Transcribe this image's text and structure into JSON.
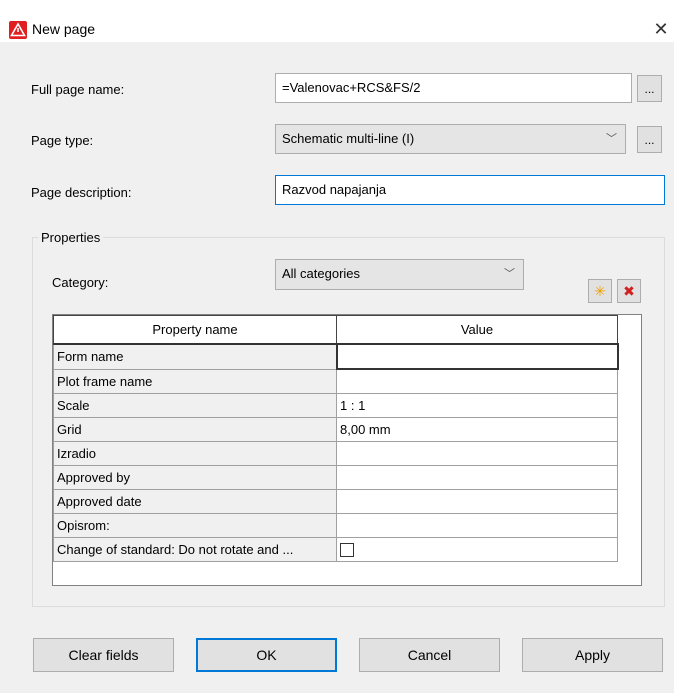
{
  "window": {
    "title": "New page",
    "close_glyph": "✕"
  },
  "form": {
    "full_page_name": {
      "label": "Full page name:",
      "value": "=Valenovac+RCS&FS/2"
    },
    "page_type": {
      "label": "Page type:",
      "value": "Schematic multi-line (I)"
    },
    "page_description": {
      "label": "Page description:",
      "value": "Razvod napajanja"
    },
    "browse_label": "..."
  },
  "properties": {
    "group_title": "Properties",
    "category_label": "Category:",
    "category_value": "All categories",
    "new_icon": "✳",
    "delete_icon": "✖",
    "columns": [
      "Property name",
      "Value"
    ],
    "rows": [
      {
        "name": "Form name",
        "value": ""
      },
      {
        "name": "Plot frame name",
        "value": ""
      },
      {
        "name": "Scale",
        "value": "1 : 1"
      },
      {
        "name": "Grid",
        "value": "8,00 mm"
      },
      {
        "name": "Izradio",
        "value": ""
      },
      {
        "name": "Approved by",
        "value": ""
      },
      {
        "name": "Approved date",
        "value": ""
      },
      {
        "name": "Opisrom:",
        "value": ""
      },
      {
        "name": "Change of standard: Do not rotate and ...",
        "value": ""
      }
    ]
  },
  "buttons": {
    "clear": "Clear fields",
    "ok": "OK",
    "cancel": "Cancel",
    "apply": "Apply"
  }
}
